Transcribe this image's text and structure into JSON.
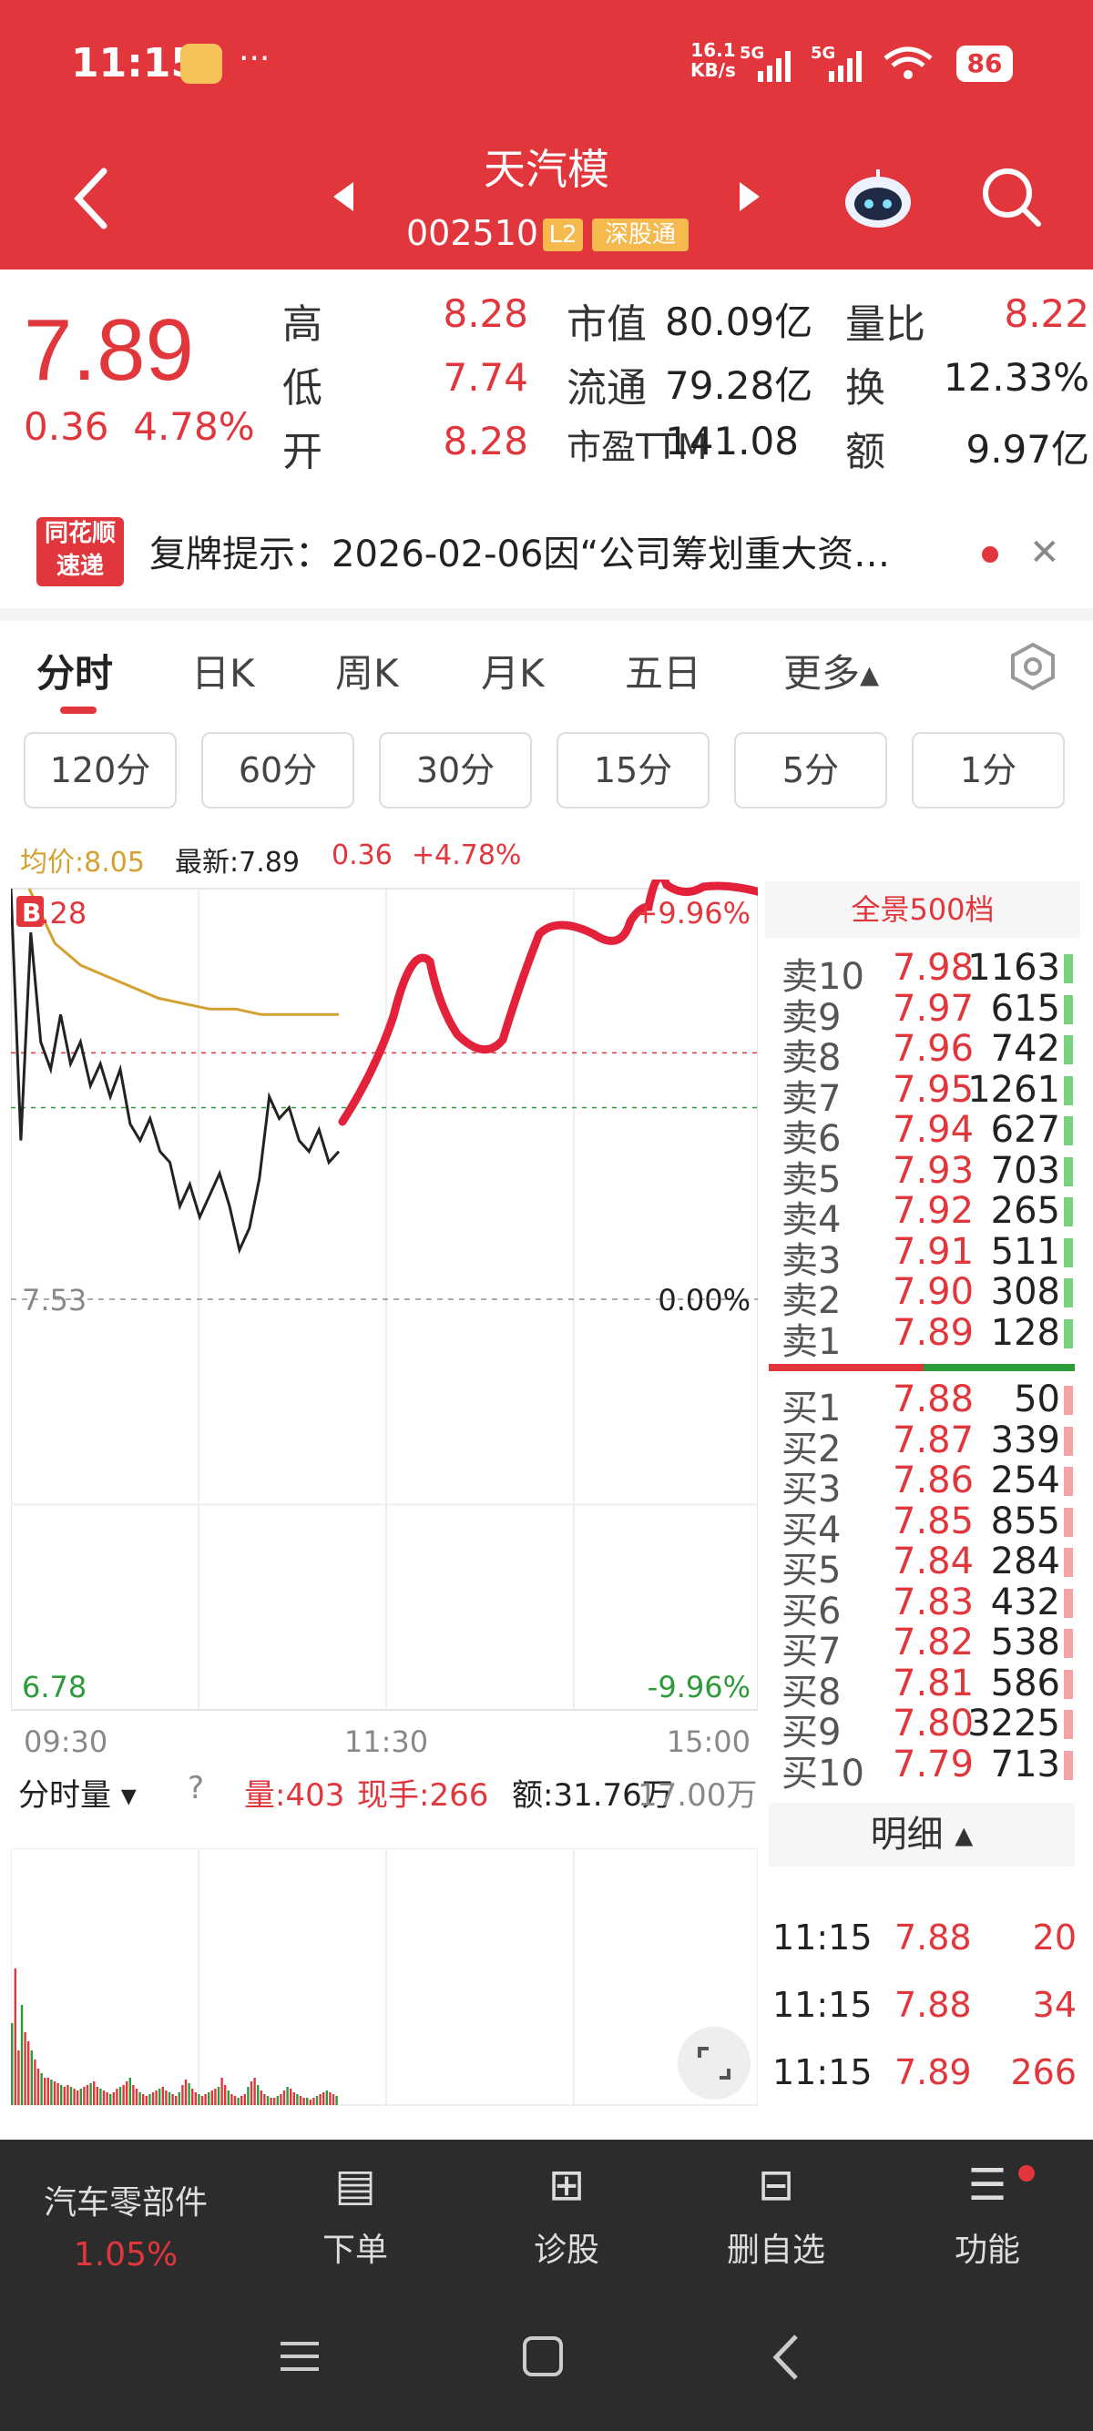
{
  "status": {
    "time": "11:15",
    "dots": "···",
    "net_speed_top": "16.1",
    "net_speed_bottom": "KB/s",
    "net1": "5G",
    "net2": "5G",
    "battery": "86"
  },
  "header": {
    "name": "天汽模",
    "code": "002510",
    "badge_l2": "L2",
    "badge_sgt": "深股通"
  },
  "quote": {
    "price": "7.89",
    "change": "0.36",
    "change_pct": "4.78%",
    "rows": [
      {
        "l1": "高",
        "v1": "8.28",
        "l2": "市值",
        "v2": "80.09亿",
        "l3": "量比",
        "v3": "8.22"
      },
      {
        "l1": "低",
        "v1": "7.74",
        "l2": "流通",
        "v2": "79.28亿",
        "l3": "换",
        "v3": "12.33%"
      },
      {
        "l1": "开",
        "v1": "8.28",
        "l2": "市盈TTM",
        "v2": "141.08",
        "l3": "额",
        "v3": "9.97亿"
      }
    ]
  },
  "notice": {
    "logo_top": "同花顺",
    "logo_bottom": "速递",
    "text": "复牌提示：2026-02-06因“公司筹划重大资…"
  },
  "tabs": [
    "分时",
    "日K",
    "周K",
    "月K",
    "五日",
    "更多▴"
  ],
  "pills": [
    "120分",
    "60分",
    "30分",
    "15分",
    "5分",
    "1分"
  ],
  "chart_info": {
    "avg": "均价:8.05",
    "latest": "最新:7.89",
    "chg": "0.36",
    "pct": "+4.78%"
  },
  "chart_axes": {
    "y_high": "8.28",
    "y_mid": "7.53",
    "y_low": "6.78",
    "pct_high": "+9.96%",
    "pct_mid": "0.00%",
    "pct_low": "-9.96%",
    "x_start": "09:30",
    "x_mid": "11:30",
    "x_end": "15:00",
    "marker": "B"
  },
  "colors": {
    "up": "#e1373c",
    "down": "#2e9b3b",
    "avg_line": "#d4a030",
    "price_line": "#222222",
    "scribble": "#e3213a"
  },
  "orderbook": {
    "title": "全景500档",
    "sells": [
      {
        "label": "卖10",
        "price": "7.98",
        "vol": "1163"
      },
      {
        "label": "卖9",
        "price": "7.97",
        "vol": "615"
      },
      {
        "label": "卖8",
        "price": "7.96",
        "vol": "742"
      },
      {
        "label": "卖7",
        "price": "7.95",
        "vol": "1261"
      },
      {
        "label": "卖6",
        "price": "7.94",
        "vol": "627"
      },
      {
        "label": "卖5",
        "price": "7.93",
        "vol": "703"
      },
      {
        "label": "卖4",
        "price": "7.92",
        "vol": "265"
      },
      {
        "label": "卖3",
        "price": "7.91",
        "vol": "511"
      },
      {
        "label": "卖2",
        "price": "7.90",
        "vol": "308"
      },
      {
        "label": "卖1",
        "price": "7.89",
        "vol": "128"
      }
    ],
    "buys": [
      {
        "label": "买1",
        "price": "7.88",
        "vol": "50"
      },
      {
        "label": "买2",
        "price": "7.87",
        "vol": "339"
      },
      {
        "label": "买3",
        "price": "7.86",
        "vol": "254"
      },
      {
        "label": "买4",
        "price": "7.85",
        "vol": "855"
      },
      {
        "label": "买5",
        "price": "7.84",
        "vol": "284"
      },
      {
        "label": "买6",
        "price": "7.83",
        "vol": "432"
      },
      {
        "label": "买7",
        "price": "7.82",
        "vol": "538"
      },
      {
        "label": "买8",
        "price": "7.81",
        "vol": "586"
      },
      {
        "label": "买9",
        "price": "7.80",
        "vol": "3225"
      },
      {
        "label": "买10",
        "price": "7.79",
        "vol": "713"
      }
    ],
    "detail_label": "明细 ▴",
    "ticks": [
      {
        "time": "11:15",
        "price": "7.88",
        "vol": "20"
      },
      {
        "time": "11:15",
        "price": "7.88",
        "vol": "34"
      },
      {
        "time": "11:15",
        "price": "7.89",
        "vol": "266"
      }
    ]
  },
  "volume": {
    "selector": "分时量 ▾",
    "help": "?",
    "vol": "量:403",
    "now": "现手:266",
    "amt": "额:31.76万",
    "scale": "17.00万"
  },
  "bottom_bar": {
    "sector": "汽车零部件",
    "sector_pct": "1.05%",
    "items": [
      "下单",
      "诊股",
      "删自选",
      "功能"
    ]
  },
  "chart_data": {
    "type": "line",
    "x_start": "09:30",
    "x_end": "15:00",
    "ylim": [
      6.78,
      8.28
    ],
    "prev_close": 7.53,
    "series": [
      {
        "values_price": [
          8.28,
          7.82,
          8.2,
          8.0,
          7.95,
          8.05,
          7.96,
          8.0,
          7.92,
          7.96,
          7.9,
          7.95,
          7.85,
          7.82,
          7.86,
          7.8,
          7.78,
          7.7,
          7.74,
          7.68,
          7.72,
          7.76,
          7.7,
          7.62,
          7.66,
          7.75,
          7.9,
          7.86,
          7.88,
          7.82,
          7.8,
          7.84,
          7.78,
          7.8
        ]
      },
      {
        "values_avg": [
          8.28,
          8.18,
          8.14,
          8.12,
          8.1,
          8.08,
          8.07,
          8.06,
          8.06,
          8.05,
          8.05,
          8.05,
          8.05
        ]
      }
    ]
  }
}
